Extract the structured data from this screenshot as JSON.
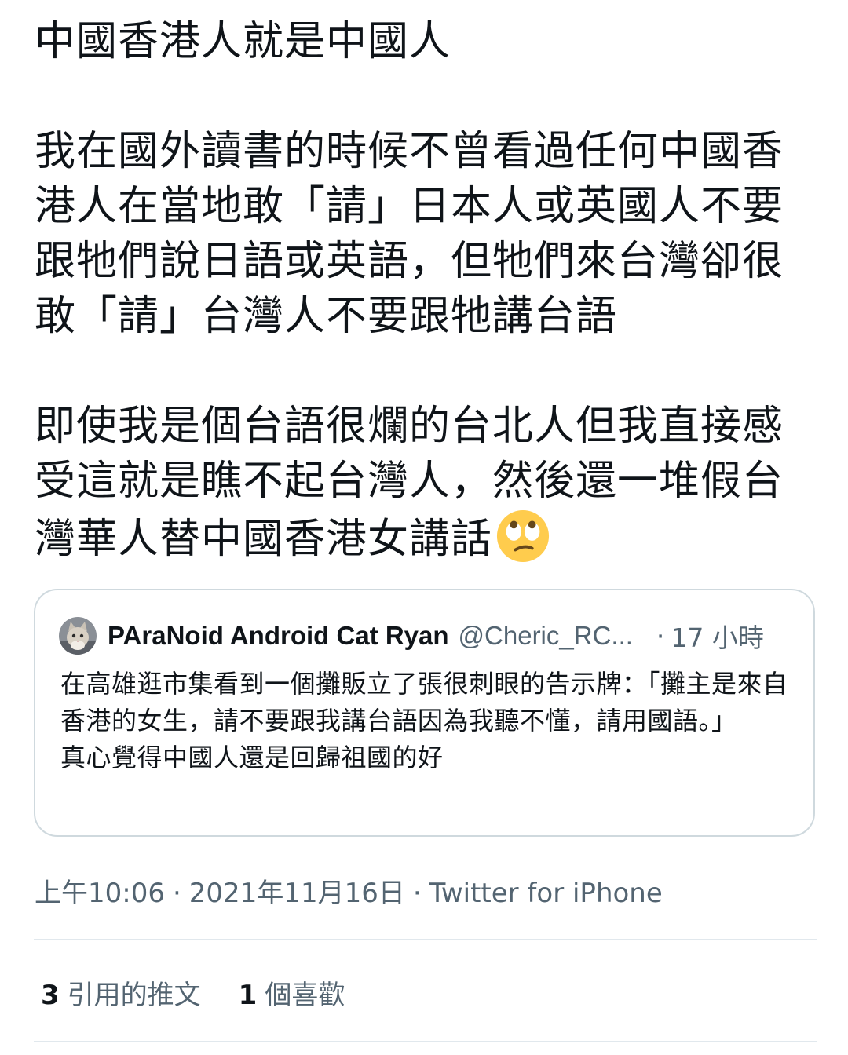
{
  "tweet": {
    "paragraphs": [
      "中國香港人就是中國人",
      "我在國外讀書的時候不曾看過任何中國香港人在當地敢「請」日本人或英國人不要跟牠們說日語或英語，但牠們來台灣卻很敢「請」台灣人不要跟牠講台語",
      "即使我是個台語很爛的台北人但我直接感受這就是瞧不起台灣人，然後還一堆假台灣華人替中國香港女講話"
    ],
    "emoji": "face-with-rolling-eyes-icon"
  },
  "quoted_tweet": {
    "name": "PAraNoid Android Cat Ryan",
    "handle": "@Cheric_RC...",
    "separator": "·",
    "time": "17 小時",
    "lines": [
      "在高雄逛市集看到一個攤販立了張很刺眼的告示牌：「攤主是來自香港的女生，請不要跟我講台語因為我聽不懂，請用國語。」",
      "真心覺得中國人還是回歸祖國的好"
    ]
  },
  "meta": {
    "time": "上午10:06",
    "dot1": "·",
    "date": "2021年11月16日",
    "dot2": "·",
    "source": "Twitter for iPhone"
  },
  "stats": {
    "quotes_count": "3",
    "quotes_label": "引用的推文",
    "likes_count": "1",
    "likes_label": "個喜歡"
  },
  "colors": {
    "text": "#0f1419",
    "secondary": "#536471",
    "border": "#cfd9de"
  }
}
